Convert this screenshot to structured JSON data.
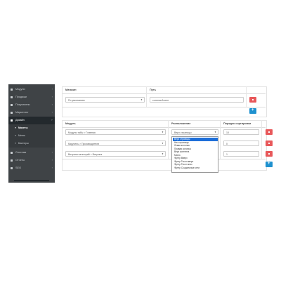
{
  "sidebar": {
    "items": [
      {
        "label": "Модули",
        "icon": "puzzle-icon"
      },
      {
        "label": "Продажи",
        "icon": "cart-icon"
      },
      {
        "label": "Покупатели",
        "icon": "user-icon"
      },
      {
        "label": "Маркетинг",
        "icon": "share-icon"
      },
      {
        "label": "Дизайн",
        "icon": "monitor-icon"
      }
    ],
    "subitems": [
      {
        "label": "Макеты"
      },
      {
        "label": "Меню"
      },
      {
        "label": "Баннеры"
      }
    ],
    "items_after": [
      {
        "label": "Система",
        "icon": "gear-icon"
      },
      {
        "label": "Отчеты",
        "icon": "chart-icon"
      },
      {
        "label": "SEO",
        "icon": "globe-icon"
      }
    ]
  },
  "top_table": {
    "col_store": "Магазин",
    "col_path": "Путь",
    "store_value": "По умолчанию",
    "path_value": "common/home"
  },
  "modules_table": {
    "col_module": "Модуль",
    "col_position": "Расположение",
    "col_sort": "Порядок сортировки",
    "rows": [
      {
        "module": "Модуль табы > Главная",
        "position": "Верх страницы",
        "sort": "10"
      },
      {
        "module": "Карусель > Производители",
        "position": "",
        "sort": "0"
      },
      {
        "module": "Витрина категорий > Витрина",
        "position": "",
        "sort": "1"
      }
    ]
  },
  "position_dropdown": {
    "options": [
      "Верх страницы",
      "Низ страницы",
      "Левая колонка",
      "Правая колонка",
      "Верх контента",
      "Меню",
      "Футер Вверх",
      "Футер Текст вверх",
      "Футер Текст вниз",
      "Футер Социальные сети"
    ],
    "selected_index": 0
  },
  "colors": {
    "sidebar_bg": "#3f4346",
    "sidebar_active": "#23292d",
    "danger": "#e8585a",
    "primary": "#1e91cf",
    "dropdown_highlight": "#1e6fd9"
  }
}
